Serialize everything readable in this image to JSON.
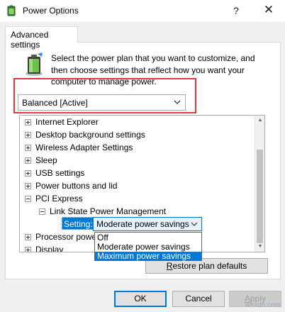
{
  "window": {
    "title": "Power Options",
    "help_glyph": "?",
    "close_glyph": "✕"
  },
  "tab": {
    "label": "Advanced settings"
  },
  "header": {
    "instruction_line1": "Select the power plan that you want to customize, and",
    "instruction_line2": "then choose settings that reflect how you want your",
    "instruction_line3": "computer to manage power."
  },
  "plan_select": {
    "value": "Balanced [Active]"
  },
  "tree": {
    "items": [
      {
        "label": "Internet Explorer",
        "expander": "+"
      },
      {
        "label": "Desktop background settings",
        "expander": "+"
      },
      {
        "label": "Wireless Adapter Settings",
        "expander": "+"
      },
      {
        "label": "Sleep",
        "expander": "+"
      },
      {
        "label": "USB settings",
        "expander": "+"
      },
      {
        "label": "Power buttons and lid",
        "expander": "+"
      },
      {
        "label": "PCI Express",
        "expander": "-"
      },
      {
        "label": "Link State Power Management",
        "expander": "-"
      },
      {
        "label": "Processor power management",
        "expander": "+"
      },
      {
        "label": "Display",
        "expander": "+"
      }
    ]
  },
  "setting": {
    "label": "Setting:",
    "value": "Moderate power savings",
    "options": [
      "Off",
      "Moderate power savings",
      "Maximum power savings"
    ],
    "highlighted_option": "Maximum power savings"
  },
  "buttons": {
    "restore_first": "R",
    "restore_rest": "estore plan defaults",
    "ok": "OK",
    "cancel": "Cancel",
    "apply_first": "A",
    "apply_rest": "pply"
  },
  "watermark": "wsxdn.com",
  "colors": {
    "accent": "#0078d7",
    "highlight_box": "#e53935",
    "selection_text": "#ffffff"
  }
}
